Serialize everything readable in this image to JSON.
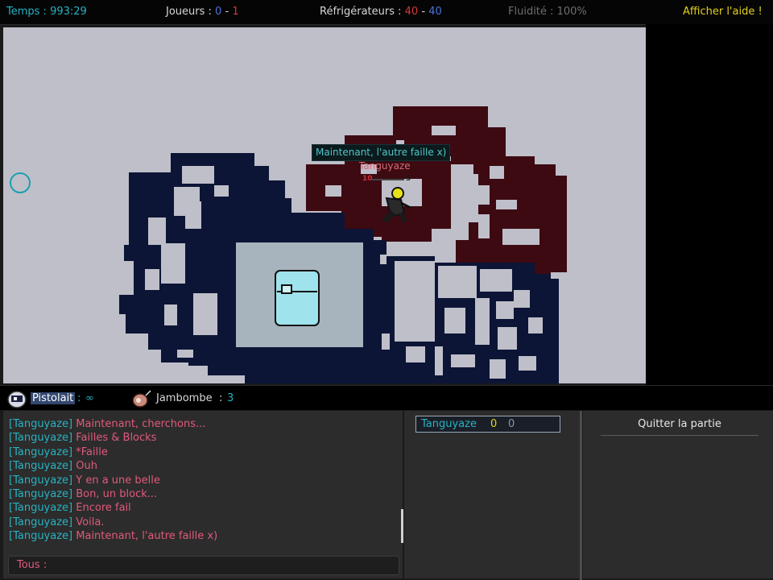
{
  "topbar": {
    "time_label": "Temps :",
    "time_value": "993:29",
    "players_label": "Joueurs :",
    "players_blue": "0",
    "players_sep": "-",
    "players_red": "1",
    "fridges_label": "Réfrigérateurs :",
    "fridges_red": "40",
    "fridges_sep": "-",
    "fridges_blue": "40",
    "fluidity_label": "Fluidité :",
    "fluidity_value": "100%",
    "help_link": "Afficher l'aide !"
  },
  "game": {
    "speech_bubble": "Maintenant, l'autre faille x)",
    "player_name": "Tanguyaze",
    "hp_left": "10",
    "hp_right": "5",
    "map_colors": {
      "background": "#bfbfca",
      "blue_team_blocks": "#0c1535",
      "red_team_blocks": "#3d0a12",
      "fridge_zone": "#a7b4bd",
      "fridge": "#9fe3ec"
    }
  },
  "weapons": {
    "weapon1_name": "Pistolait",
    "weapon1_sep": ":",
    "weapon1_ammo": "∞",
    "weapon2_name": "Jambombe",
    "weapon2_sep": ":",
    "weapon2_ammo": "3"
  },
  "chat": {
    "messages": [
      {
        "name": "[Tanguyaze]",
        "text": "Maintenant, cherchons..."
      },
      {
        "name": "[Tanguyaze]",
        "text": "Failles & Blocks"
      },
      {
        "name": "[Tanguyaze]",
        "text": "*Faille"
      },
      {
        "name": "[Tanguyaze]",
        "text": "Ouh"
      },
      {
        "name": "[Tanguyaze]",
        "text": "Y en a une belle"
      },
      {
        "name": "[Tanguyaze]",
        "text": "Bon, un block..."
      },
      {
        "name": "[Tanguyaze]",
        "text": "Encore fail"
      },
      {
        "name": "[Tanguyaze]",
        "text": "Voila."
      },
      {
        "name": "[Tanguyaze]",
        "text": "Maintenant, l'autre faille x)"
      }
    ],
    "input_scope": "Tous :",
    "input_value": ""
  },
  "players_list": [
    {
      "name": "Tanguyaze",
      "score1": "0",
      "score2": "0"
    }
  ],
  "options": {
    "quit_button": "Quitter la partie"
  },
  "colors": {
    "cyan": "#27b3c2",
    "pink": "#e05a7c",
    "yellow": "#e3d21c",
    "red": "#d23a3a",
    "blue": "#4c73d6"
  }
}
